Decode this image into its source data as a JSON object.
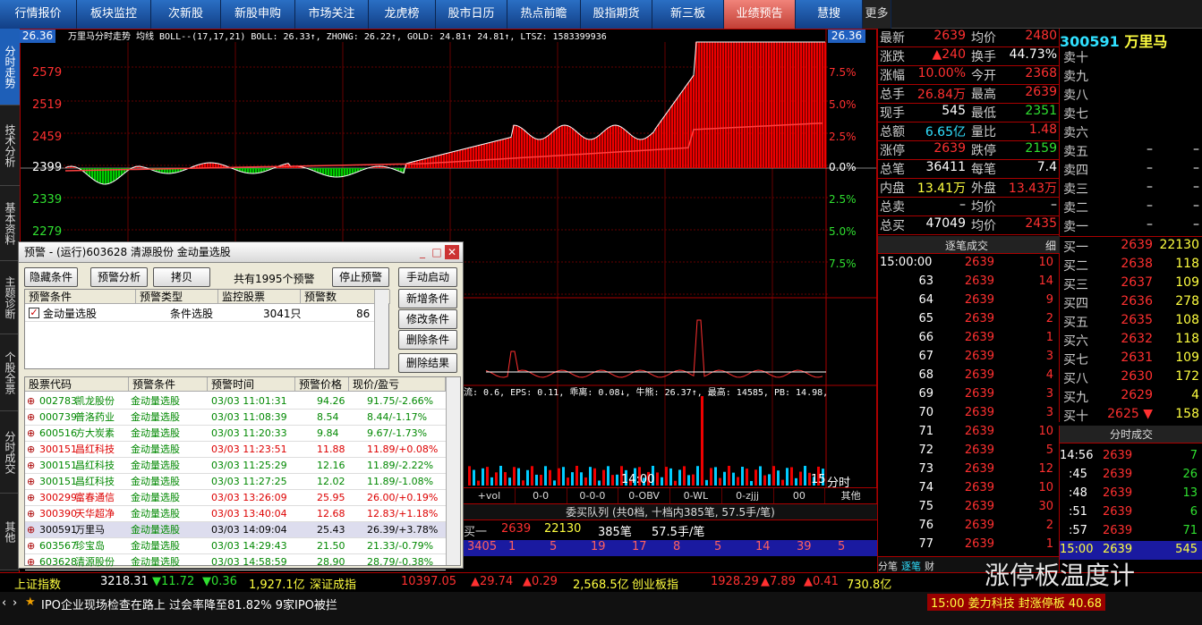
{
  "nav": {
    "tabs": [
      "行情报价",
      "板块监控",
      "次新股",
      "新股申购",
      "市场关注",
      "龙虎榜",
      "股市日历",
      "热点前瞻",
      "股指期货",
      "新三板",
      "业绩预告",
      "慧搜",
      "更多"
    ]
  },
  "left_tabs": [
    "分时走势",
    "技术分析",
    "基本资料",
    "主题诊断",
    "个股全景",
    "分时成交",
    "其他"
  ],
  "chart": {
    "header": "万里马分时走势 均线 BOLL--(17,17,21) BOLL: 26.33↑, ZHONG: 26.22↑, GOLD: 24.81↑ 24.81↑, LTSZ: 1583399936",
    "price_top": "26.36",
    "price_top_right": "26.36",
    "y_labels": [
      "2579",
      "2519",
      "2459",
      "2399",
      "2339",
      "2279"
    ],
    "pct_labels": [
      "7.5%",
      "5.0%",
      "2.5%",
      "0.0%",
      "2.5%",
      "5.0%",
      "7.5%"
    ],
    "time_label": "14:00",
    "time_right": "15",
    "fenshi": "分时",
    "indicator_text": "流: 0.6, EPS: 0.11, 乖离: 0.08↓, 牛熊: 26.37↑, 最高: 14585, PB: 14.98,",
    "sub_tabs": [
      "+vol",
      "0-0",
      "0-0-0",
      "0-OBV",
      "0-WL",
      "0-zjjj",
      "00",
      "其他"
    ]
  },
  "quote": {
    "code": "300591",
    "name": "万里马",
    "rows": [
      [
        "最新",
        "2639",
        "均价",
        "2480"
      ],
      [
        "涨跌",
        "▲240",
        "换手",
        "44.73%"
      ],
      [
        "涨幅",
        "10.00%",
        "今开",
        "2368"
      ],
      [
        "总手",
        "26.84万",
        "最高",
        "2639"
      ],
      [
        "现手",
        "545",
        "最低",
        "2351"
      ],
      [
        "总额",
        "6.65亿",
        "量比",
        "1.48"
      ],
      [
        "涨停",
        "2639",
        "跌停",
        "2159"
      ],
      [
        "总笔",
        "36411",
        "每笔",
        "7.4"
      ],
      [
        "内盘",
        "13.41万",
        "外盘",
        "13.43万"
      ],
      [
        "总卖",
        "–",
        "均价",
        "–"
      ],
      [
        "总买",
        "47049",
        "均价",
        "2435"
      ]
    ]
  },
  "book": {
    "sell": [
      [
        "卖十",
        "",
        ""
      ],
      [
        "卖九",
        "",
        ""
      ],
      [
        "卖八",
        "",
        ""
      ],
      [
        "卖七",
        "",
        ""
      ],
      [
        "卖六",
        "",
        ""
      ],
      [
        "卖五",
        "–",
        "–"
      ],
      [
        "卖四",
        "–",
        "–"
      ],
      [
        "卖三",
        "–",
        "–"
      ],
      [
        "卖二",
        "–",
        "–"
      ],
      [
        "卖一",
        "–",
        "–"
      ]
    ],
    "buy": [
      [
        "买一",
        "2639",
        "22130"
      ],
      [
        "买二",
        "2638",
        "118"
      ],
      [
        "买三",
        "2637",
        "109"
      ],
      [
        "买四",
        "2636",
        "278"
      ],
      [
        "买五",
        "2635",
        "108"
      ],
      [
        "买六",
        "2632",
        "118"
      ],
      [
        "买七",
        "2631",
        "109"
      ],
      [
        "买八",
        "2630",
        "172"
      ],
      [
        "买九",
        "2629",
        "4"
      ],
      [
        "买十",
        "2625 ▼",
        "158"
      ]
    ]
  },
  "ticks": {
    "header": "逐笔成交",
    "header_btn": "细",
    "rows": [
      [
        "15:00:00",
        "2639",
        "10"
      ],
      [
        "63",
        "2639",
        "14"
      ],
      [
        "64",
        "2639",
        "9"
      ],
      [
        "65",
        "2639",
        "2"
      ],
      [
        "66",
        "2639",
        "1"
      ],
      [
        "67",
        "2639",
        "3"
      ],
      [
        "68",
        "2639",
        "4"
      ],
      [
        "69",
        "2639",
        "3"
      ],
      [
        "70",
        "2639",
        "3"
      ],
      [
        "71",
        "2639",
        "10"
      ],
      [
        "72",
        "2639",
        "5"
      ],
      [
        "73",
        "2639",
        "12"
      ],
      [
        "74",
        "2639",
        "10"
      ],
      [
        "75",
        "2639",
        "30"
      ],
      [
        "76",
        "2639",
        "2"
      ],
      [
        "77",
        "2639",
        "1"
      ]
    ],
    "footer": [
      "分笔",
      "逐笔",
      "财"
    ]
  },
  "minitrade": {
    "header": "分时成交",
    "rows": [
      [
        "14:56",
        "2639",
        "7"
      ],
      [
        ":45",
        "2639",
        "26"
      ],
      [
        ":48",
        "2639",
        "13"
      ],
      [
        ":51",
        "2639",
        "6"
      ],
      [
        ":57",
        "2639",
        "71"
      ],
      [
        "15:00",
        "2639",
        "545"
      ]
    ]
  },
  "queue": {
    "title": "委买队列 (共0档, 十档内385笔, 57.5手/笔)",
    "row1": [
      "买一",
      "2639",
      "22130",
      "385笔",
      "57.5手/笔"
    ],
    "row2": [
      "3405",
      "1",
      "5",
      "19",
      "17",
      "8",
      "5",
      "14",
      "39",
      "5"
    ]
  },
  "popup": {
    "title": "预警 - (运行)603628 清源股份 金动量选股",
    "buttons": [
      "隐藏条件",
      "预警分析",
      "拷贝",
      "停止预警",
      "手动启动",
      "新增条件",
      "修改条件",
      "删除条件",
      "删除结果"
    ],
    "count_text": "共有1995个预警",
    "cond_headers": [
      "预警条件",
      "预警类型",
      "监控股票",
      "预警数"
    ],
    "cond_row": [
      "金动量选股",
      "条件选股",
      "3041只",
      "86"
    ],
    "res_headers": [
      "股票代码",
      "预警条件",
      "预警时间",
      "预警价格",
      "现价/盈亏"
    ],
    "results": [
      [
        "002783",
        "凯龙股份",
        "金动量选股",
        "03/03 11:01:31",
        "94.26",
        "91.75/-2.66%",
        "g"
      ],
      [
        "000739",
        "普洛药业",
        "金动量选股",
        "03/03 11:08:39",
        "8.54",
        "8.44/-1.17%",
        "g"
      ],
      [
        "600516",
        "方大炭素",
        "金动量选股",
        "03/03 11:20:33",
        "9.84",
        "9.67/-1.73%",
        "g"
      ],
      [
        "300151",
        "昌红科技",
        "金动量选股",
        "03/03 11:23:51",
        "11.88",
        "11.89/+0.08%",
        "r"
      ],
      [
        "300151",
        "昌红科技",
        "金动量选股",
        "03/03 11:25:29",
        "12.16",
        "11.89/-2.22%",
        "g"
      ],
      [
        "300151",
        "昌红科技",
        "金动量选股",
        "03/03 11:27:25",
        "12.02",
        "11.89/-1.08%",
        "g"
      ],
      [
        "300299",
        "富春通信",
        "金动量选股",
        "03/03 13:26:09",
        "25.95",
        "26.00/+0.19%",
        "r"
      ],
      [
        "300390",
        "天华超净",
        "金动量选股",
        "03/03 13:40:04",
        "12.68",
        "12.83/+1.18%",
        "r"
      ],
      [
        "300591",
        "万里马",
        "金动量选股",
        "03/03 14:09:04",
        "25.43",
        "26.39/+3.78%",
        "k"
      ],
      [
        "603567",
        "珍宝岛",
        "金动量选股",
        "03/03 14:29:43",
        "21.50",
        "21.33/-0.79%",
        "g"
      ],
      [
        "603628",
        "清源股份",
        "金动量选股",
        "03/03 14:58:59",
        "28.90",
        "28.79/-0.38%",
        "g"
      ]
    ]
  },
  "status": {
    "sh_name": "上证指数",
    "sh": "3218.31",
    "sh_chg": "▼11.72",
    "sh_chg2": "▼0.36",
    "sh_amt": "1,927.1亿",
    "sz_name": "深证成指",
    "sz": "10397.05",
    "sz_chg": "▲29.74",
    "sz_chg2": "▲0.29",
    "sz_amt": "2,568.5亿",
    "cy_name": "创业板指",
    "cy": "1928.29",
    "cy_chg": "▲7.89",
    "cy_chg2": "▲0.41",
    "cy_amt": "730.8亿"
  },
  "news": {
    "text": "IPO企业现场检查在路上 过会率降至81.82% 9家IPO被拦",
    "alert": "15:00 姜力科技 封涨停板 40.68",
    "watermark": "涨停板温度计"
  }
}
